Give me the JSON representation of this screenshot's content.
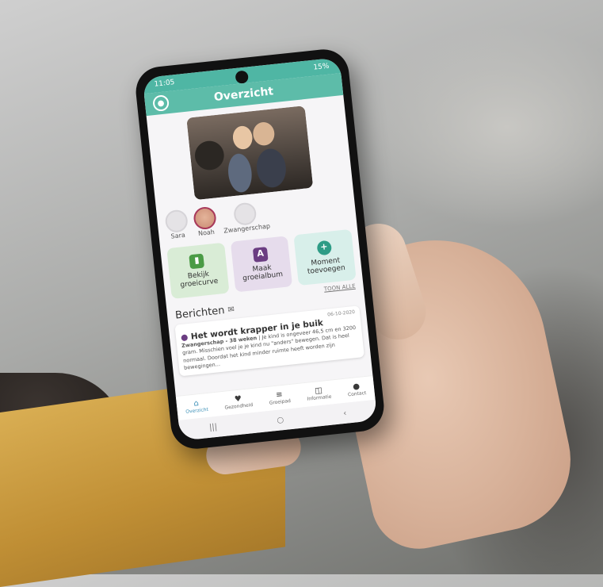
{
  "status": {
    "time": "11:05",
    "battery": "15%"
  },
  "app": {
    "title": "Overzicht"
  },
  "profiles": [
    {
      "name": "Sara",
      "active": false
    },
    {
      "name": "Noah",
      "active": true
    },
    {
      "name": "Zwangerschap",
      "active": false
    }
  ],
  "actions": [
    {
      "icon": "ruler-icon",
      "label_line1": "Bekijk",
      "label_line2": "groeicurve"
    },
    {
      "icon": "album-icon",
      "label_line1": "Maak",
      "label_line2": "groeialbum"
    },
    {
      "icon": "plus-icon",
      "label_line1": "Moment",
      "label_line2": "toevoegen"
    }
  ],
  "toon_alle": "TOON ALLE",
  "messages": {
    "heading": "Berichten",
    "card": {
      "date": "06-10-2020",
      "title": "Het wordt krapper in je buik",
      "body_bold": "Zwangerschap - 38 weken",
      "body": " | Je kind is ongeveer 46,5 cm en 3200 gram. Misschien voel je je kind nu \"anders\" bewegen. Dat is heel normaal. Doordat het kind minder ruimte heeft worden zijn bewegingen..."
    }
  },
  "tabs": [
    {
      "label": "Overzicht",
      "icon": "home-icon",
      "active": true
    },
    {
      "label": "Gezondheid",
      "icon": "heart-icon",
      "active": false
    },
    {
      "label": "Groeipad",
      "icon": "steps-icon",
      "active": false
    },
    {
      "label": "Informatie",
      "icon": "book-icon",
      "active": false
    },
    {
      "label": "Contact",
      "icon": "chat-icon",
      "active": false
    }
  ],
  "colors": {
    "accent": "#5dbca9",
    "active_tab": "#3a8fb7",
    "purple": "#6b3d82"
  }
}
